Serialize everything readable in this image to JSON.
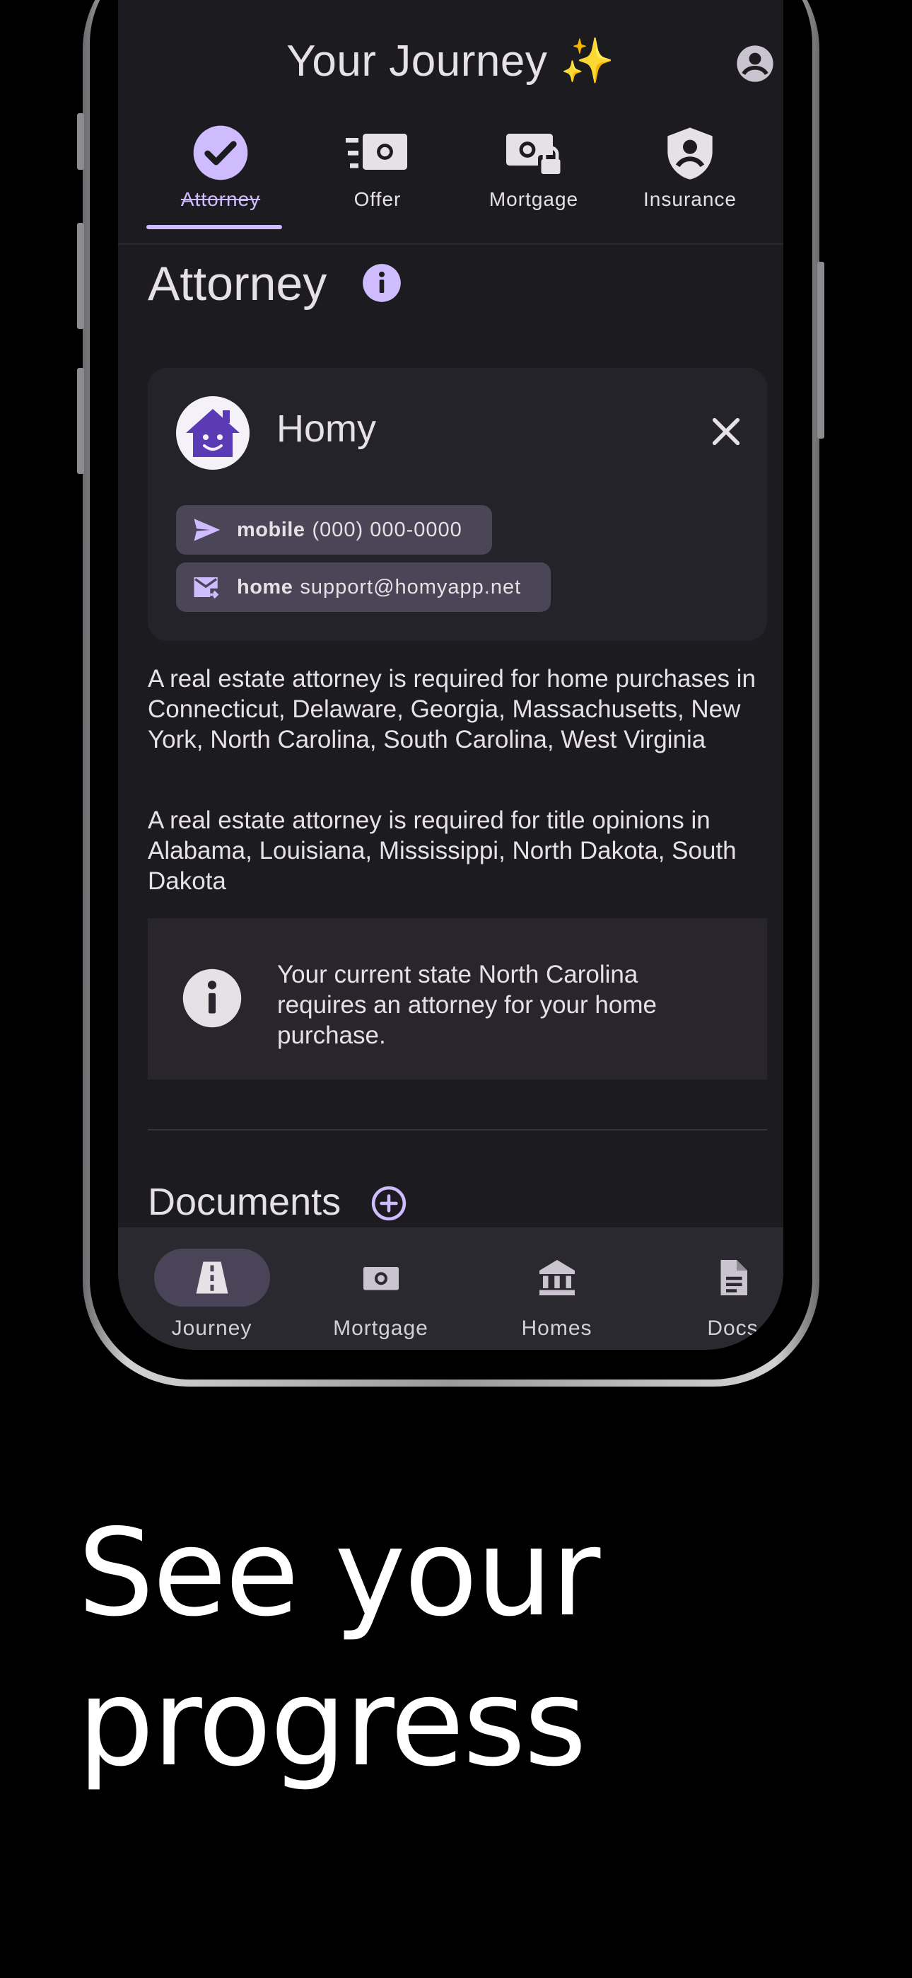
{
  "header": {
    "title": "Your Journey ✨"
  },
  "steps": [
    {
      "label": "Attorney",
      "icon": "check-circle-icon",
      "state": "completed"
    },
    {
      "label": "Offer",
      "icon": "payments-icon"
    },
    {
      "label": "Mortgage",
      "icon": "locked-money-icon"
    },
    {
      "label": "Insurance",
      "icon": "shield-person-icon"
    }
  ],
  "section": {
    "title": "Attorney"
  },
  "contact": {
    "name": "Homy",
    "phone": {
      "type": "mobile",
      "value": "(000) 000-0000"
    },
    "email": {
      "type": "home",
      "value": "support@homyapp.net"
    }
  },
  "paragraphs": [
    "A real estate attorney is required for home purchases in Connecticut, Delaware, Georgia, Massachusetts, New York, North Carolina, South Carolina, West Virginia",
    "A real estate attorney is required for title opinions in Alabama, Louisiana, Mississippi, North Dakota, South Dakota"
  ],
  "note": {
    "text": "Your current state North Carolina requires an attorney for your home purchase."
  },
  "documents": {
    "title": "Documents"
  },
  "bottom_nav": [
    {
      "label": "Journey",
      "icon": "road-icon",
      "active": true
    },
    {
      "label": "Mortgage",
      "icon": "payments-icon"
    },
    {
      "label": "Homes",
      "icon": "bank-icon"
    },
    {
      "label": "Docs",
      "icon": "document-icon"
    }
  ],
  "caption": {
    "line1": "See your",
    "line2": "progress"
  },
  "colors": {
    "accent": "#cfbcff",
    "surface": "#1c1b1f",
    "card": "#25232a",
    "chip": "#4a4658"
  }
}
